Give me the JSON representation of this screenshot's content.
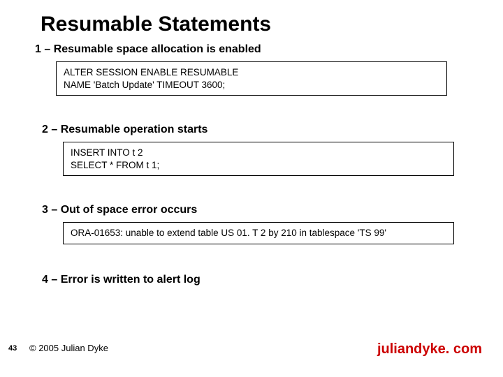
{
  "title": "Resumable Statements",
  "steps": [
    {
      "heading": "1 – Resumable space allocation is enabled",
      "code": "ALTER SESSION ENABLE RESUMABLE\nNAME 'Batch Update' TIMEOUT 3600;"
    },
    {
      "heading": "2 – Resumable operation starts",
      "code": "INSERT INTO t 2\nSELECT * FROM t 1;"
    },
    {
      "heading": "3 – Out of space error occurs",
      "code": "ORA-01653: unable to extend table US 01. T 2 by 210 in tablespace 'TS 99'"
    },
    {
      "heading": "4 – Error is written to alert log"
    }
  ],
  "footer": {
    "page": "43",
    "copyright": "© 2005 Julian Dyke",
    "domain": "juliandyke. com"
  }
}
